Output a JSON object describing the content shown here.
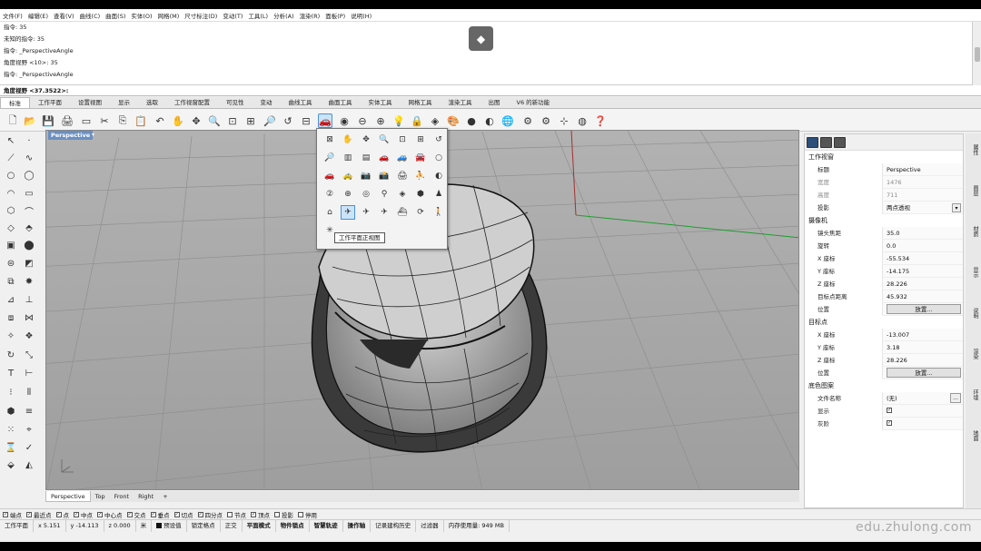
{
  "menu": [
    "文件(F)",
    "编辑(E)",
    "查看(V)",
    "曲线(C)",
    "曲面(S)",
    "实体(O)",
    "网格(M)",
    "尺寸标注(D)",
    "变动(T)",
    "工具(L)",
    "分析(A)",
    "渲染(R)",
    "面板(P)",
    "说明(H)"
  ],
  "command_history": [
    "指令: 35",
    "未知的指令: 35",
    "指令: _PerspectiveAngle",
    "角度视野 <10>: 35",
    "指令: _PerspectiveAngle"
  ],
  "prompt": "角度视野 <37.3522>:",
  "tabs": [
    {
      "label": "标准",
      "active": true
    },
    {
      "label": "工作平面"
    },
    {
      "label": "设置视图"
    },
    {
      "label": "显示"
    },
    {
      "label": "选取"
    },
    {
      "label": "工作视窗配置"
    },
    {
      "label": "可见性"
    },
    {
      "label": "变动"
    },
    {
      "label": "曲线工具"
    },
    {
      "label": "曲面工具"
    },
    {
      "label": "实体工具"
    },
    {
      "label": "网格工具"
    },
    {
      "label": "渲染工具"
    },
    {
      "label": "出图"
    },
    {
      "label": "V6 的新功能"
    }
  ],
  "viewport": {
    "name": "Perspective"
  },
  "tooltip": "工作平面正视图",
  "viewport_tabs": [
    {
      "label": "Perspective",
      "active": true
    },
    {
      "label": "Top"
    },
    {
      "label": "Front"
    },
    {
      "label": "Right"
    },
    {
      "label": "+"
    }
  ],
  "osnaps": [
    {
      "label": "端点",
      "on": true
    },
    {
      "label": "最近点",
      "on": true
    },
    {
      "label": "点",
      "on": true
    },
    {
      "label": "中点",
      "on": true
    },
    {
      "label": "中心点",
      "on": true
    },
    {
      "label": "交点",
      "on": true
    },
    {
      "label": "垂点",
      "on": true
    },
    {
      "label": "切点",
      "on": true
    },
    {
      "label": "四分点",
      "on": true
    },
    {
      "label": "节点",
      "on": false
    },
    {
      "label": "顶点",
      "on": true
    },
    {
      "label": "投影",
      "on": false
    },
    {
      "label": "停用",
      "on": false
    }
  ],
  "status": {
    "cplane": "工作平面",
    "x": "x 5.151",
    "y": "y -14.113",
    "z": "z 0.000",
    "unit": "米",
    "layer": "预设值",
    "items": [
      "锁定格点",
      "正交",
      "平面模式",
      "物件锁点",
      "智慧轨迹",
      "操作轴",
      "记录建构历史",
      "过滤器",
      "内存使用量: 949 MB"
    ]
  },
  "watermark": "edu.zhulong.com",
  "properties": {
    "section_viewport": "工作视窗",
    "title_label": "标题",
    "title_value": "Perspective",
    "width_label": "宽度",
    "width_value": "1476",
    "height_label": "高度",
    "height_value": "711",
    "projection_label": "投影",
    "projection_value": "两点透视",
    "section_camera": "摄像机",
    "lens_label": "镜头焦距",
    "lens_value": "35.0",
    "rotation_label": "旋转",
    "rotation_value": "0.0",
    "cx_label": "X 座标",
    "cx_value": "-55.534",
    "cy_label": "Y 座标",
    "cy_value": "-14.175",
    "cz_label": "Z 座标",
    "cz_value": "28.226",
    "dist_label": "目标点距离",
    "dist_value": "45.932",
    "pos_label": "位置",
    "place_button": "放置...",
    "section_target": "目标点",
    "tx_label": "X 座标",
    "tx_value": "-13.007",
    "ty_label": "Y 座标",
    "ty_value": "3.18",
    "tz_label": "Z 座标",
    "tz_value": "28.226",
    "tpos_label": "位置",
    "tplace_button": "放置...",
    "section_wallpaper": "底色图案",
    "file_label": "文件名称",
    "file_value": "(无)",
    "show_label": "显示",
    "gray_label": "灰阶"
  },
  "side_tabs": [
    "属性",
    "图层",
    "材质",
    "显示",
    "说明",
    "渲染",
    "环境",
    "地面"
  ]
}
